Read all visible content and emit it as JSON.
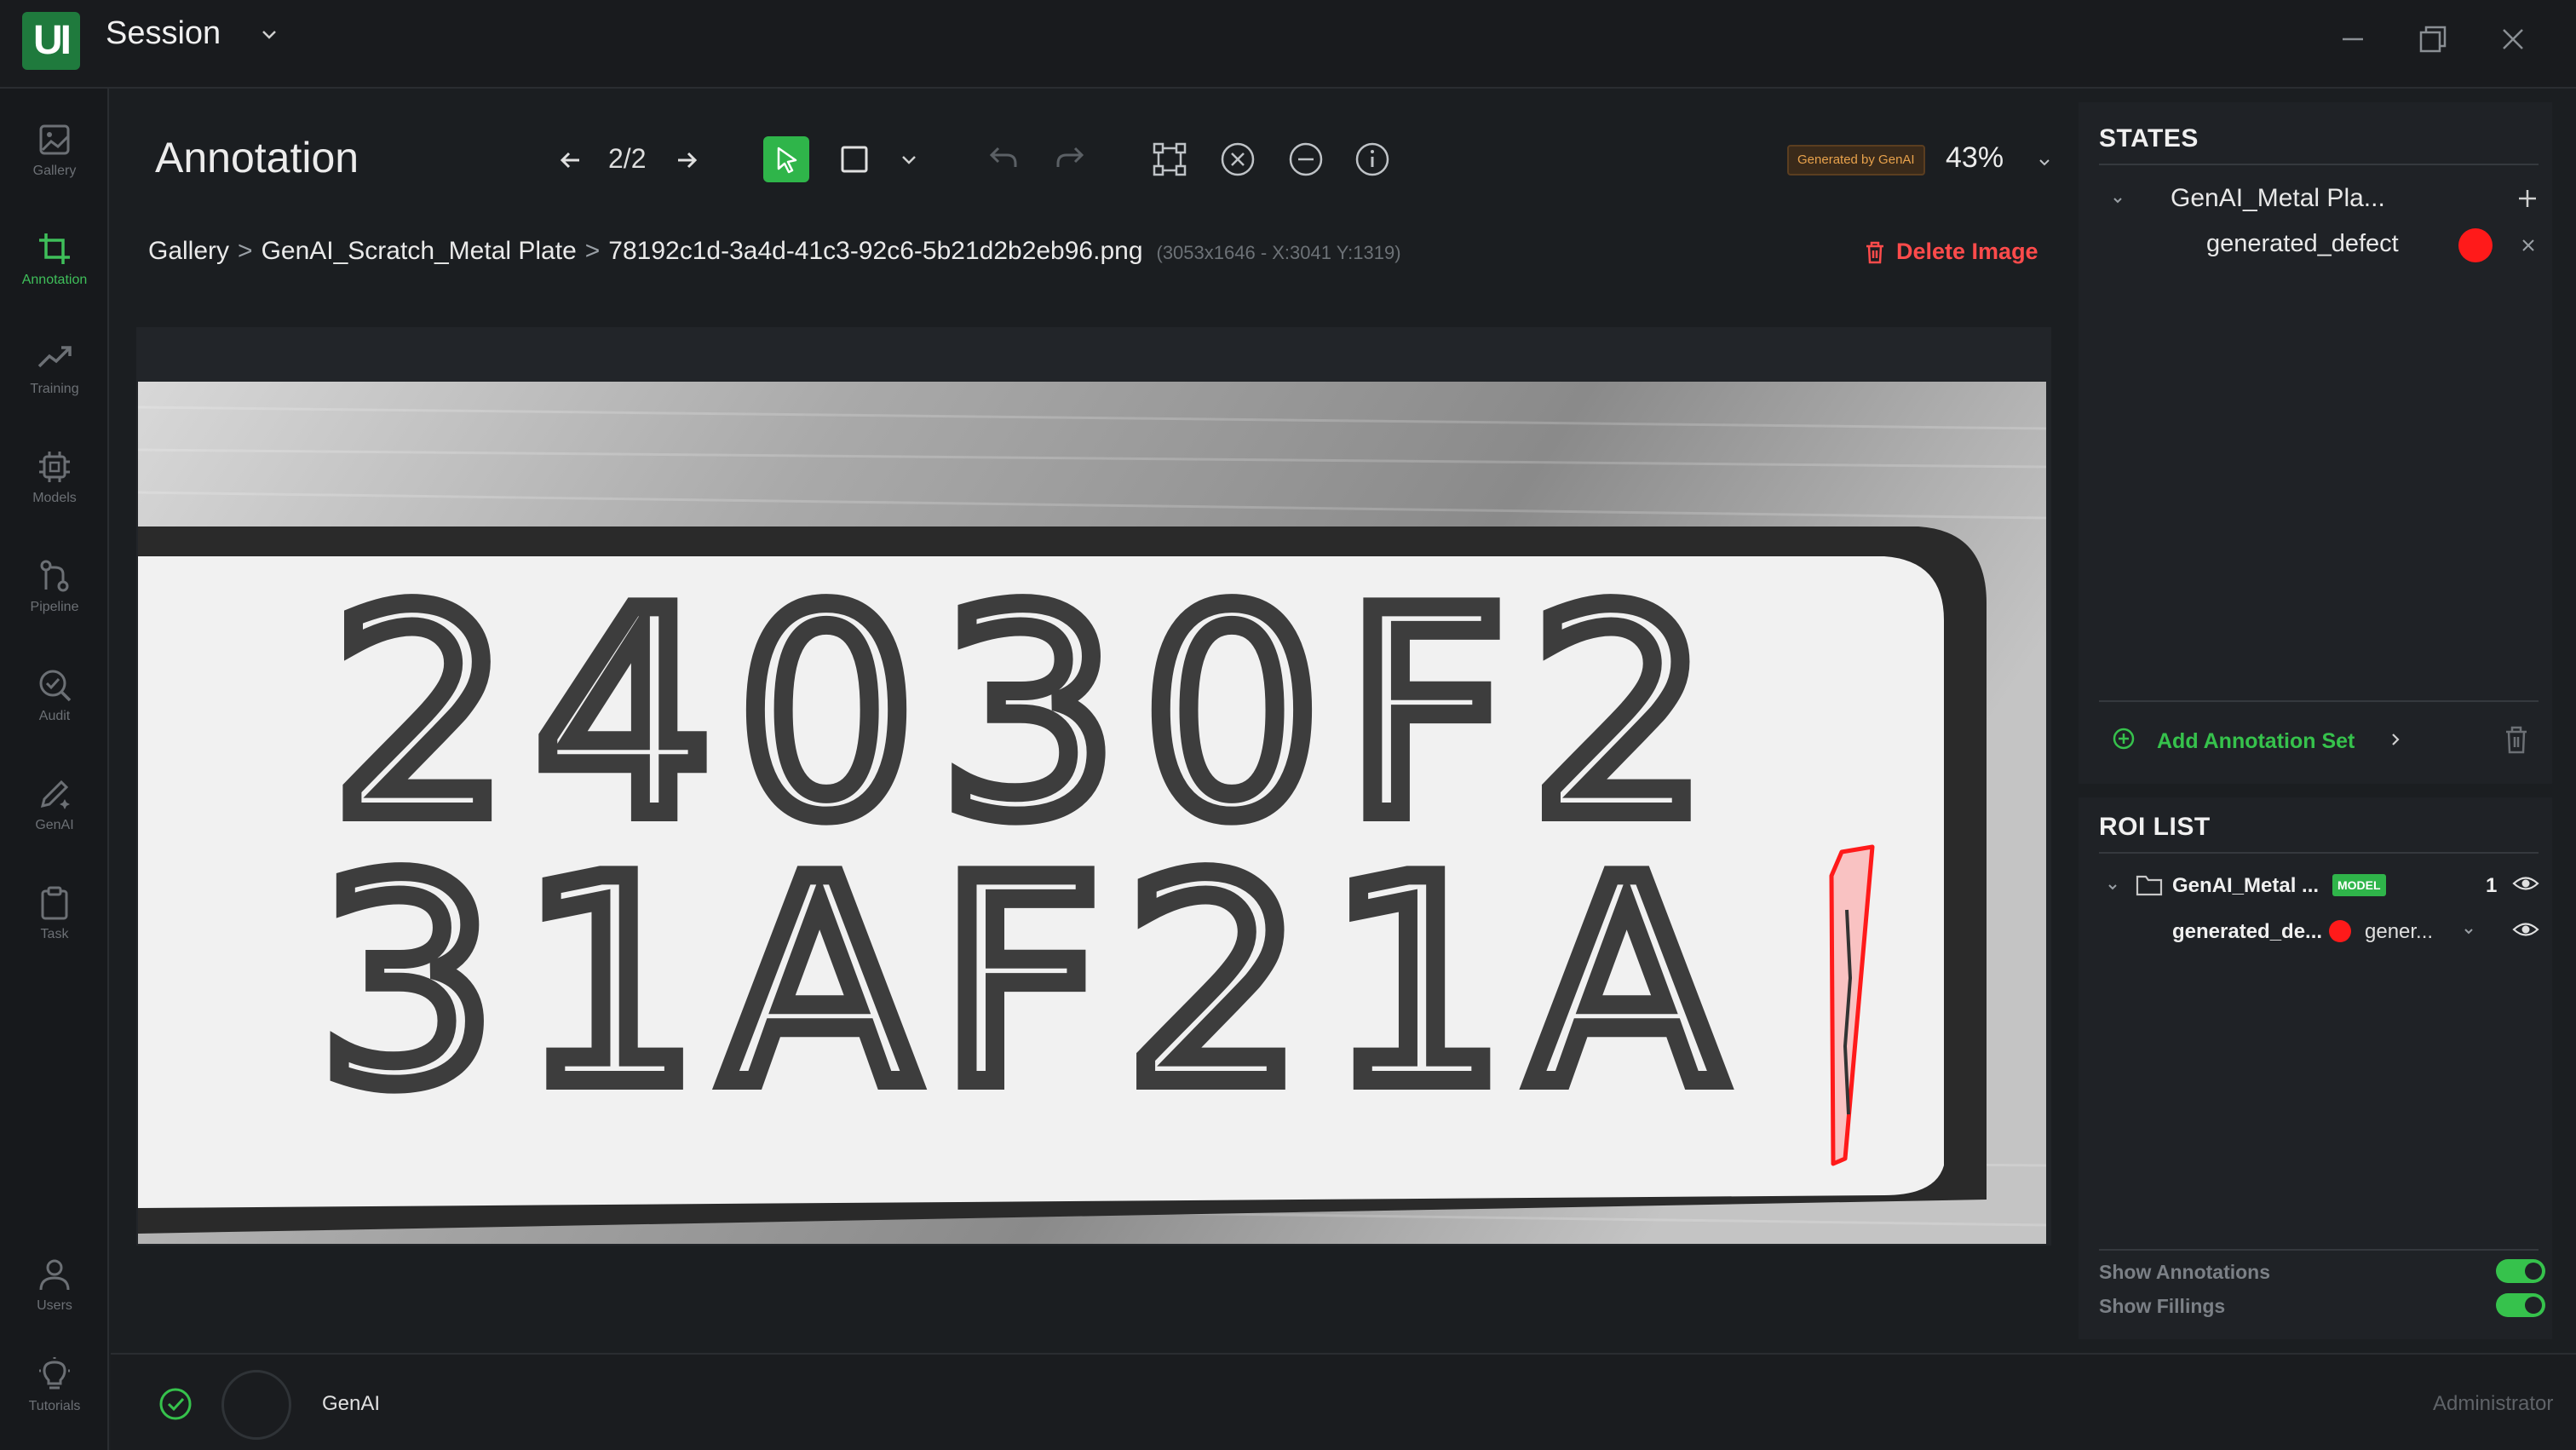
{
  "app": {
    "logo_text": "UI",
    "session_title": "Session"
  },
  "nav": [
    {
      "label": "Gallery",
      "icon": "image-icon"
    },
    {
      "label": "Annotation",
      "icon": "crop-icon",
      "active": true
    },
    {
      "label": "Training",
      "icon": "trend-icon"
    },
    {
      "label": "Models",
      "icon": "chip-icon"
    },
    {
      "label": "Pipeline",
      "icon": "pipeline-icon"
    },
    {
      "label": "Audit",
      "icon": "check-search-icon"
    },
    {
      "label": "GenAI",
      "icon": "pen-sparkle-icon"
    },
    {
      "label": "Task",
      "icon": "clipboard-icon"
    },
    {
      "label": "Users",
      "icon": "user-icon"
    },
    {
      "label": "Tutorials",
      "icon": "bulb-icon"
    }
  ],
  "header": {
    "title": "Annotation",
    "pager": "2/2",
    "genai_badge": "Generated by GenAI",
    "zoom": "43%"
  },
  "breadcrumb": {
    "gallery": "Gallery",
    "dataset": "GenAI_Scratch_Metal Plate",
    "file": "78192c1d-3a4d-41c3-92c6-5b21d2b2eb96.png",
    "meta": "(3053x1646 - X:3041 Y:1319)",
    "sep": ">"
  },
  "delete_image": "Delete Image",
  "plate": {
    "line1": "24030F2",
    "line2": "31AF21A"
  },
  "states": {
    "title": "STATES",
    "set_name": "GenAI_Metal Pla...",
    "state_name": "generated_defect",
    "state_color": "#ff1a1a",
    "add_set": "Add Annotation Set"
  },
  "roi": {
    "title": "ROI LIST",
    "folder_name": "GenAI_Metal ...",
    "badge": "MODEL",
    "count": "1",
    "item_name": "generated_de...",
    "item_state": "gener...",
    "show_annotations": "Show Annotations",
    "show_fillings": "Show Fillings"
  },
  "bottom": {
    "label": "GenAI",
    "user": "Administrator"
  },
  "colors": {
    "accent": "#2fb54a",
    "danger": "#ff4b4b",
    "defect": "#ff1a1a"
  }
}
